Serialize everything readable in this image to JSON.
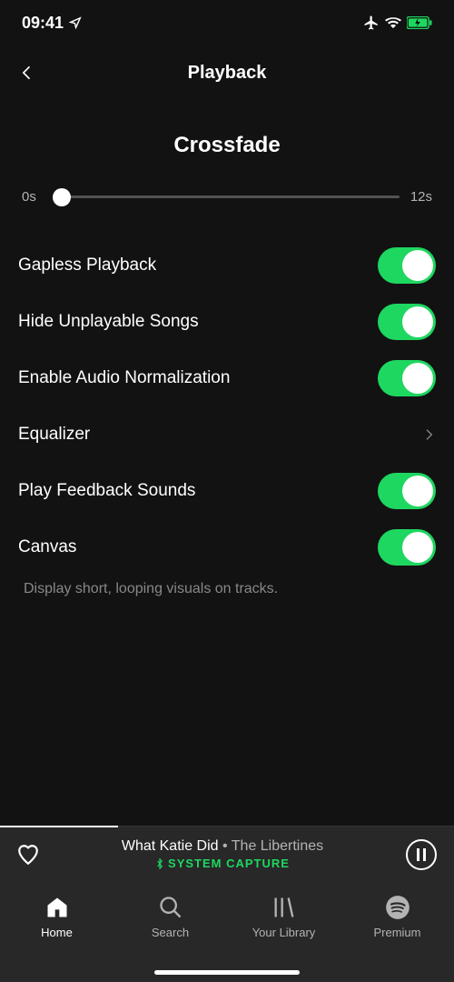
{
  "status": {
    "time": "09:41"
  },
  "header": {
    "title": "Playback"
  },
  "crossfade": {
    "title": "Crossfade",
    "min_label": "0s",
    "max_label": "12s"
  },
  "settings": {
    "gapless": {
      "label": "Gapless Playback",
      "on": true
    },
    "hide_unplayable": {
      "label": "Hide Unplayable Songs",
      "on": true
    },
    "normalization": {
      "label": "Enable Audio Normalization",
      "on": true
    },
    "equalizer": {
      "label": "Equalizer"
    },
    "feedback_sounds": {
      "label": "Play Feedback Sounds",
      "on": true
    },
    "canvas": {
      "label": "Canvas",
      "on": true,
      "hint": "Display short, looping visuals on tracks."
    }
  },
  "now_playing": {
    "track": "What Katie Did",
    "separator": " • ",
    "artist": "The Libertines",
    "device": "SYSTEM CAPTURE",
    "progress_percent": 26
  },
  "tabs": {
    "home": "Home",
    "search": "Search",
    "library": "Your Library",
    "premium": "Premium"
  }
}
